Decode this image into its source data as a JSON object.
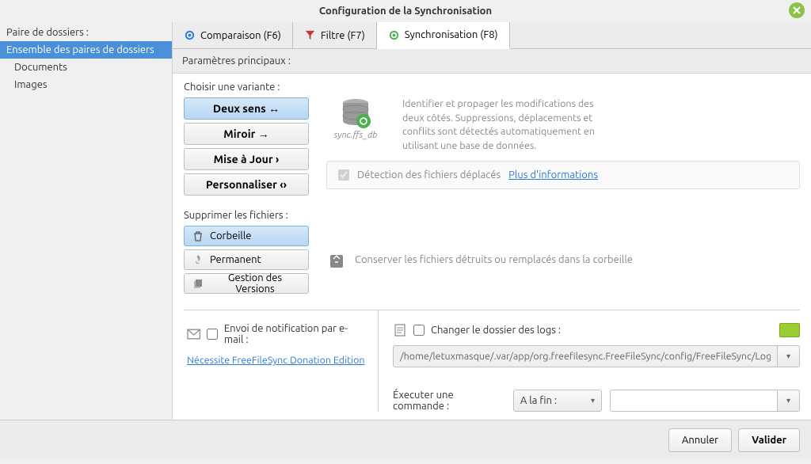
{
  "window": {
    "title": "Configuration de la Synchronisation"
  },
  "sidebar": {
    "header": "Paire de dossiers :",
    "items": [
      {
        "label": "Ensemble des paires de dossiers",
        "selected": true,
        "topLevel": true
      },
      {
        "label": "Documents",
        "selected": false,
        "topLevel": false
      },
      {
        "label": "Images",
        "selected": false,
        "topLevel": false
      }
    ]
  },
  "tabs": {
    "comparison": "Comparaison (F6)",
    "filter": "Filtre (F7)",
    "sync": "Synchronisation (F8)"
  },
  "subheader": "Paramètres principaux :",
  "variant": {
    "label": "Choisir une variante :",
    "twoWay": "Deux sens ↔",
    "mirror": "Miroir →",
    "update": "Mise à Jour ›",
    "custom": "Personnaliser ‹›",
    "dbCaption": "sync.ffs_db",
    "description": "Identifier et propager les modifications des deux côtés. Suppressions, déplacements et conflits sont détectés automatiquement en utilisant une base de données."
  },
  "detect": {
    "label": "Détection des fichiers déplacés",
    "link": "Plus d'informations"
  },
  "delete": {
    "label": "Supprimer les fichiers :",
    "recycle": "Corbeille",
    "permanent": "Permanent",
    "versions": "Gestion des Versions",
    "keepText": "Conserver les fichiers détruits ou remplacés dans la corbeille"
  },
  "email": {
    "label": "Envoi de notification par e-mail :",
    "link": "Nécessite FreeFileSync Donation Edition"
  },
  "logs": {
    "changeLabel": "Changer le dossier des logs :",
    "path": "/home/letuxmasque/.var/app/org.freefilesync.FreeFileSync/config/FreeFileSync/Logs"
  },
  "exec": {
    "label": "Éxecuter une commande :",
    "selected": "A la fin :",
    "command": ""
  },
  "footer": {
    "cancel": "Annuler",
    "ok": "Valider"
  }
}
